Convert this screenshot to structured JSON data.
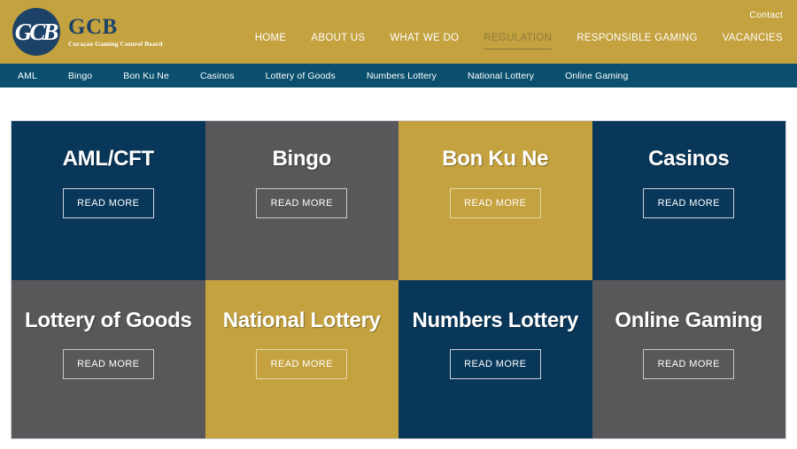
{
  "header": {
    "logo": {
      "monogram": "GCB",
      "title": "GCB",
      "subtitle": "Curaçao Gaming Control Board"
    },
    "contact_label": "Contact",
    "nav_items": [
      {
        "label": "HOME",
        "active": false
      },
      {
        "label": "ABOUT US",
        "active": false
      },
      {
        "label": "WHAT WE DO",
        "active": false
      },
      {
        "label": "REGULATION",
        "active": true
      },
      {
        "label": "RESPONSIBLE GAMING",
        "active": false
      },
      {
        "label": "VACANCIES",
        "active": false
      }
    ],
    "colors": {
      "background": "#c4a23f",
      "brand_navy": "#1d4267",
      "active_nav": "#8d7a3f"
    }
  },
  "subnav": {
    "background": "#0a4f6e",
    "items": [
      {
        "label": "AML"
      },
      {
        "label": "Bingo"
      },
      {
        "label": "Bon Ku Ne"
      },
      {
        "label": "Casinos"
      },
      {
        "label": "Lottery of Goods"
      },
      {
        "label": "Numbers Lottery"
      },
      {
        "label": "National Lottery"
      },
      {
        "label": "Online Gaming"
      }
    ]
  },
  "grid": {
    "read_more_label": "READ MORE",
    "palette": {
      "navy": "#08375a",
      "gray": "#58585a",
      "gold": "#c4a23f"
    },
    "tiles": [
      {
        "title": "AML/CFT",
        "color": "navy",
        "button": "READ MORE"
      },
      {
        "title": "Bingo",
        "color": "gray",
        "button": "READ MORE"
      },
      {
        "title": "Bon Ku Ne",
        "color": "gold",
        "button": "READ MORE"
      },
      {
        "title": "Casinos",
        "color": "navy",
        "button": "READ MORE"
      },
      {
        "title": "Lottery of Goods",
        "color": "gray",
        "button": "READ MORE"
      },
      {
        "title": "National Lottery",
        "color": "gold",
        "button": "READ MORE"
      },
      {
        "title": "Numbers Lottery",
        "color": "navy",
        "button": "READ MORE"
      },
      {
        "title": "Online Gaming",
        "color": "gray",
        "button": "READ MORE"
      }
    ]
  }
}
